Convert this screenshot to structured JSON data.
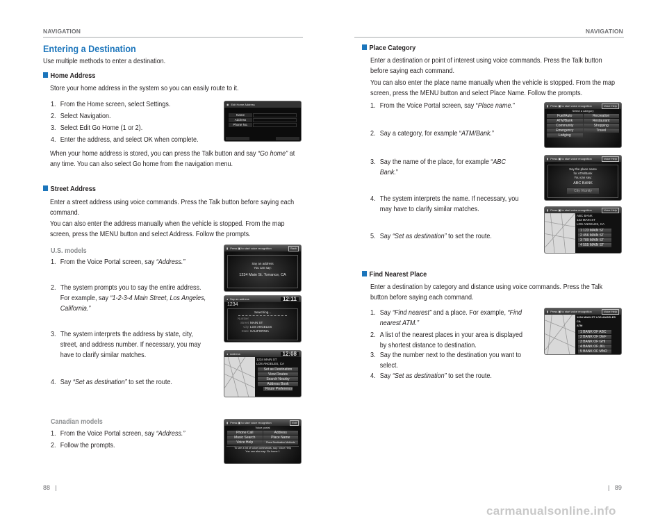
{
  "left": {
    "header": "NAVIGATION",
    "title": "Entering a Destination",
    "intro": "Use multiple methods to enter a destination.",
    "home": {
      "heading": "Home Address",
      "desc": "Store your home address in the system so you can easily route to it.",
      "steps": [
        "1.",
        "From the Home screen, select Settings.",
        "2.",
        "Select Navigation.",
        "3.",
        "Select Edit Go Home (1 or 2).",
        "4.",
        "Enter the address, and select OK when complete."
      ],
      "note": [
        "When your home address is stored, you can press the Talk button and say ",
        "“Go home”",
        " at any time. You can also select Go home from the navigation menu."
      ],
      "screen": {
        "title": "Edit Home Address",
        "fields": [
          "Name",
          "Address",
          "Phone No."
        ]
      }
    },
    "street": {
      "heading": "Street Address",
      "p1": "Enter a street address using voice commands. Press the Talk button before saying each command.",
      "p2": "You can also enter the address manually when the vehicle is stopped. From the map screen, press the MENU button and select Address. Follow the prompts.",
      "us_label": "U.S. models",
      "us_steps": [
        {
          "n": "1.",
          "a": "From the Voice Portal screen, say ",
          "i": "“Address.”",
          "b": ""
        },
        {
          "n": "2.",
          "a": "The system prompts you to say the entire address. For example, say ",
          "i": "“1-2-3-4 Main Street, Los Angeles, California.”",
          "b": ""
        },
        {
          "n": "3.",
          "a": "The system interprets the address by state, city, street, and address number. If necessary, you may have to clarify similar matches.",
          "i": "",
          "b": ""
        },
        {
          "n": "4.",
          "a": "Say ",
          "i": "“Set as destination”",
          "b": " to set the route."
        }
      ],
      "ca_label": "Canadian models",
      "ca_steps": [
        {
          "n": "1.",
          "a": "From the Voice Portal screen, say ",
          "i": "“Address.”"
        },
        {
          "n": "2.",
          "a": "Follow the prompts.",
          "i": ""
        }
      ],
      "screen_voice": {
        "bar": "Press ▣ to start voice recognition",
        "back": "Back",
        "l1": "Say an address",
        "l2": "You can say:",
        "l3": "1234 Main St. Torrance, CA"
      },
      "screen_search": {
        "title": "Say an address",
        "time": "12:11",
        "entry": "1234",
        "status": "Searching...",
        "rows": [
          [
            "Number",
            ""
          ],
          [
            "Street",
            "MAIN ST"
          ],
          [
            "City",
            "LOS ANGELES"
          ],
          [
            "State",
            "CALIFORNIA"
          ]
        ]
      },
      "screen_address": {
        "title": "Address",
        "time": "12:08",
        "l1": "1234 MAIN ST",
        "l2": "LOS ANGELES, CA",
        "buttons": [
          "Set as Destination",
          "View Routes",
          "Search Nearby",
          "Address Book"
        ],
        "pref": "Route Preference"
      },
      "screen_portal": {
        "bar": "Press ▣ to start voice recognition",
        "exit": "Exit",
        "title": "Voice portal",
        "items": [
          "Phone Call",
          "Address",
          "Music Search",
          "Place Name",
          "Voice Help",
          "Place Destination Methods"
        ],
        "f1": "To see a list of voice commands, say: Voice Help",
        "f2": "You can also say: Go home 1"
      }
    },
    "page": "88"
  },
  "right": {
    "header": "NAVIGATION",
    "place": {
      "heading": "Place Category",
      "p1": "Enter a destination or point of interest using voice commands. Press the Talk button before saying each command.",
      "p2": "You can also enter the place name manually when the vehicle is stopped. From the map screen, press the MENU button and select Place Name. Follow the prompts.",
      "steps": [
        {
          "n": "1.",
          "a": "From the Voice Portal screen, say “",
          "i": "Place name.",
          "b": "”"
        },
        {
          "n": "2.",
          "a": "Say a category, for example “",
          "i": "ATM/Bank.",
          "b": "”"
        },
        {
          "n": "3.",
          "a": "Say the name of the place, for example “",
          "i": "ABC Bank.",
          "b": "”"
        },
        {
          "n": "4.",
          "a": "The system interprets the name. If necessary, you may have to clarify similar matches.",
          "i": "",
          "b": ""
        },
        {
          "n": "5.",
          "a": "Say ",
          "i": "“Set as destination”",
          "b": " to set the route."
        }
      ],
      "screen_cat": {
        "bar": "Press ▣ to start voice recognition",
        "help": "Voice Help",
        "title": "Select a category",
        "items": [
          "Fuel/Auto",
          "Recreation",
          "ATM/Bank",
          "Restaurant",
          "Community",
          "Shopping",
          "Emergency",
          "Travel",
          "Lodging"
        ]
      },
      "screen_say": {
        "bar": "Press ▣ to start voice recognition",
        "help": "Voice Help",
        "l1": "Say the place name",
        "l2": "for ATM/Bank",
        "l3": "You can say:",
        "l4": "ABC BANK",
        "btn": "City Vicinity"
      },
      "screen_res": {
        "bar": "Press ▣ to start voice recognition",
        "help": "Voice Help",
        "l1": "ABC BANK",
        "l2": "123 MAIN ST",
        "l3": "LOS ANGELES, CA",
        "items": [
          "1 123 MAIN ST",
          "2 456 MAIN ST",
          "3 789 MAIN ST",
          "4 555 MAIN ST"
        ]
      }
    },
    "nearest": {
      "heading": "Find Nearest Place",
      "p1": "Enter a destination by category and distance using voice commands. Press the Talk button before saying each command.",
      "steps": [
        {
          "n": "1.",
          "a": "Say ",
          "i": "“Find nearest”",
          "b": " and a place. For example, ",
          "i2": "“Find nearest ATM.”"
        },
        {
          "n": "2.",
          "a": "A list of the nearest places in your area is displayed by shortest distance to destination.",
          "i": "",
          "b": "",
          "i2": ""
        },
        {
          "n": "3.",
          "a": "Say the number next to the destination you want to select.",
          "i": "",
          "b": "",
          "i2": ""
        },
        {
          "n": "4.",
          "a": "Say ",
          "i": "“Set as destination”",
          "b": " to set the route.",
          "i2": ""
        }
      ],
      "screen": {
        "bar": "Press ▣ to start voice recognition",
        "help": "Voice Help",
        "l1": "1234 MAIN ST LOS ANGELES CA",
        "l2": "ATM",
        "items": [
          "1  BANK OF ABC",
          "2  BANK OF DEF",
          "3  BANK OF GHI",
          "4  BANK OF JKL",
          "5  BANK OF MNO"
        ]
      }
    },
    "page": "89"
  },
  "watermark": "carmanualsonline.info",
  "colors": {
    "accent": "#1b75bb",
    "rule": "#a7a9ac"
  }
}
